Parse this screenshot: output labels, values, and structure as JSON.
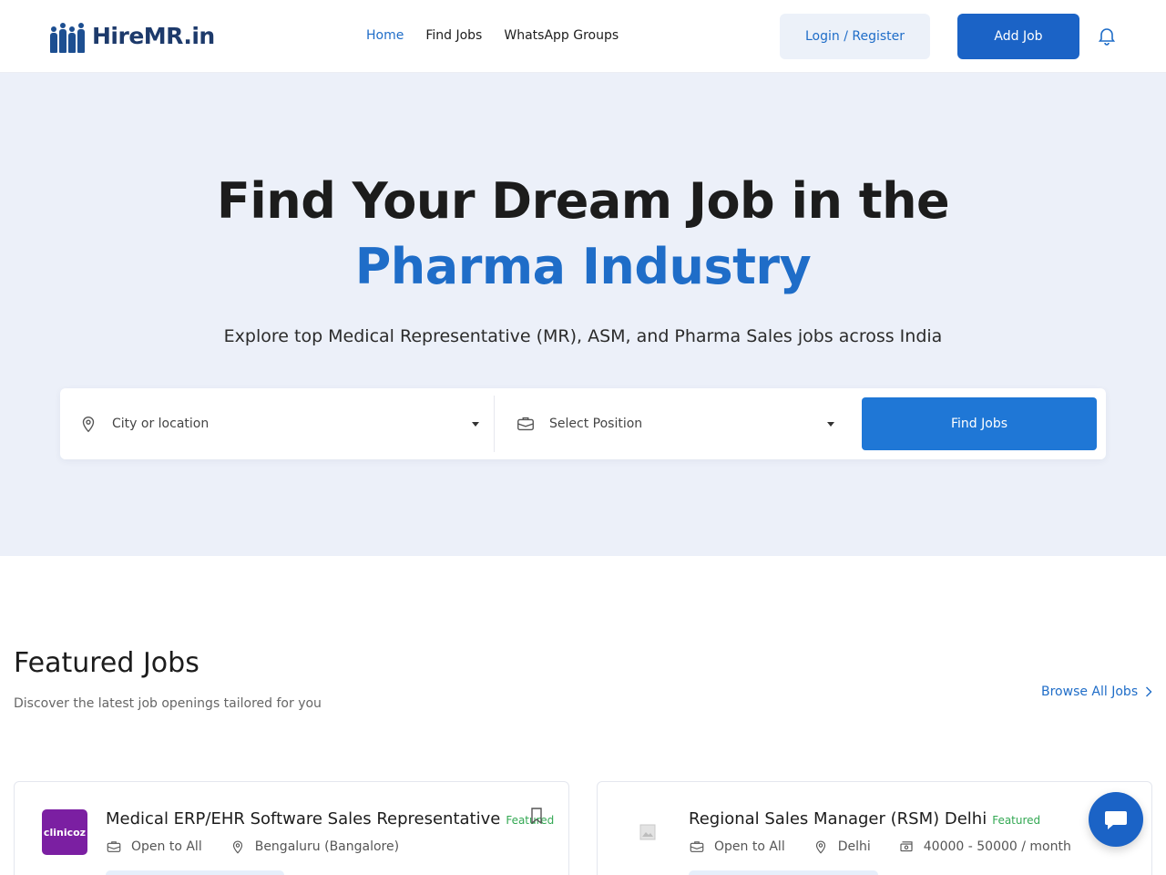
{
  "header": {
    "brand": "HireMR.in",
    "nav": [
      {
        "label": "Home",
        "active": true
      },
      {
        "label": "Find Jobs",
        "active": false
      },
      {
        "label": "WhatsApp Groups",
        "active": false
      }
    ],
    "login_label": "Login / Register",
    "add_job_label": "Add Job",
    "notification_icon": "bell-icon"
  },
  "hero": {
    "title_line1": "Find Your Dream Job in the",
    "title_line2": "Pharma Industry",
    "subtitle": "Explore top Medical Representative (MR), ASM, and Pharma Sales jobs across India",
    "search": {
      "location_placeholder": "City or location",
      "position_placeholder": "Select Position",
      "button_label": "Find Jobs"
    }
  },
  "featured": {
    "title": "Featured Jobs",
    "subtitle": "Discover the latest job openings tailored for you",
    "browse_label": "Browse All Jobs",
    "jobs": [
      {
        "logo_text": "clinicoz",
        "title": "Medical ERP/EHR Software Sales Representative",
        "tag": "Featured",
        "eligibility": "Open to All",
        "location": "Bengaluru (Bangalore)"
      },
      {
        "logo_text": "",
        "title": "Regional Sales Manager (RSM) Delhi",
        "tag": "Featured",
        "eligibility": "Open to All",
        "location": "Delhi",
        "salary": "40000 -  50000 / month"
      }
    ]
  },
  "colors": {
    "primary": "#1b63c6",
    "accent_text": "#1f6dc8",
    "hero_bg": "#ecf0f9",
    "featured_tag": "#33a853"
  }
}
